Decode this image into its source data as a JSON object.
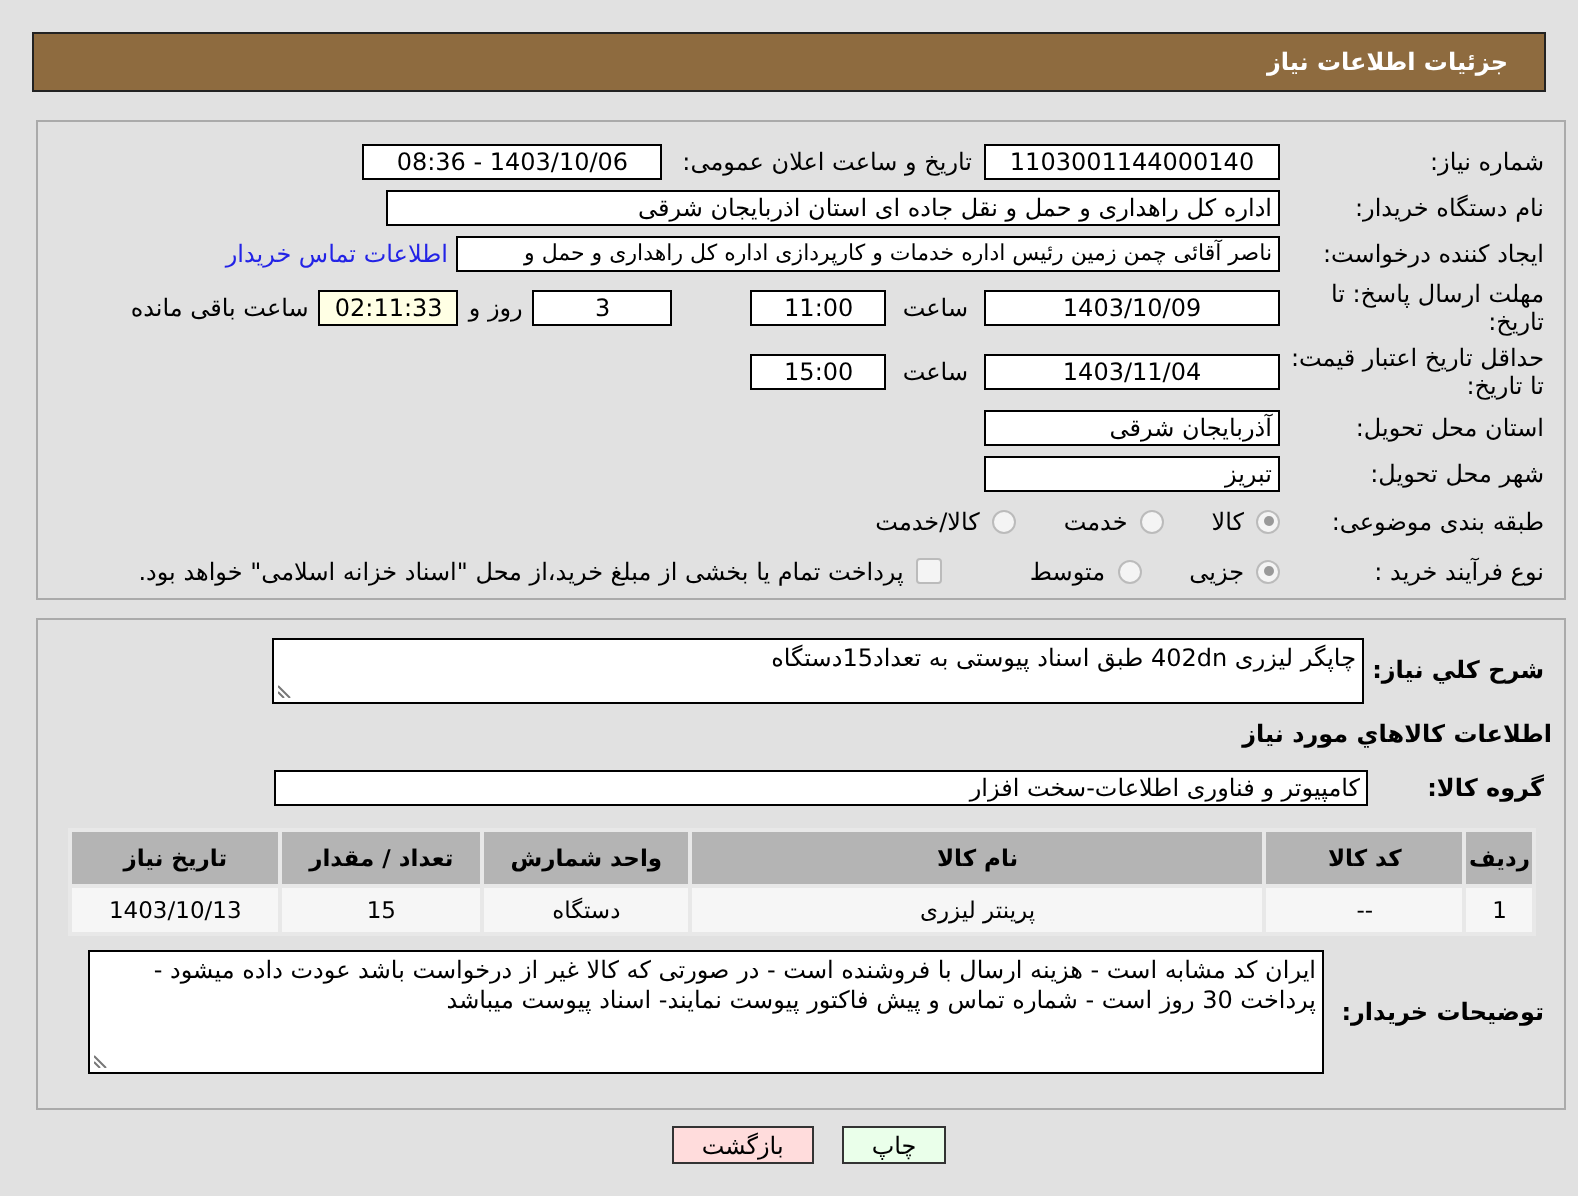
{
  "header": {
    "title": "جزئیات اطلاعات نیاز"
  },
  "need_number": {
    "label": "شماره نیاز:",
    "value": "1103001144000140"
  },
  "announce": {
    "label": "تاریخ و ساعت اعلان عمومی:",
    "value": "1403/10/06 - 08:36"
  },
  "buyer": {
    "label": "نام دستگاه خریدار:",
    "value": "اداره کل راهداری و حمل و نقل جاده ای استان اذربایجان شرقی"
  },
  "requester": {
    "label": "ایجاد کننده درخواست:",
    "value": "ناصر آقائی چمن زمین رئیس اداره خدمات و کارپردازی اداره کل راهداری و حمل و",
    "link": "اطلاعات تماس خریدار"
  },
  "deadline": {
    "label": "مهلت ارسال پاسخ: تا تاریخ:",
    "date": "1403/10/09",
    "time_label": "ساعت",
    "time": "11:00",
    "days": "3",
    "days_label": "روز و",
    "remaining": "02:11:33",
    "remaining_label": "ساعت باقی مانده"
  },
  "validity": {
    "label": "حداقل تاریخ اعتبار قیمت: تا تاریخ:",
    "date": "1403/11/04",
    "time_label": "ساعت",
    "time": "15:00"
  },
  "province": {
    "label": "استان محل تحویل:",
    "value": "آذربایجان شرقی"
  },
  "city": {
    "label": "شهر محل تحویل:",
    "value": "تبریز"
  },
  "category": {
    "label": "طبقه بندی موضوعی:",
    "options": [
      {
        "label": "کالا",
        "selected": true
      },
      {
        "label": "خدمت",
        "selected": false
      },
      {
        "label": "کالا/خدمت",
        "selected": false
      }
    ]
  },
  "process": {
    "label": "نوع فرآیند خرید :",
    "options": [
      {
        "label": "جزیی",
        "selected": true
      },
      {
        "label": "متوسط",
        "selected": false
      }
    ],
    "payment": {
      "label": "پرداخت تمام یا بخشی از مبلغ خرید،از محل \"اسناد خزانه اسلامی\" خواهد بود.",
      "checked": false
    }
  },
  "description": {
    "label": "شرح كلي نياز:",
    "value": "چاپگر لیزری 402dn طبق اسناد پیوستی به تعداد15دستگاه"
  },
  "goods_title": "اطلاعات كالاهاي مورد نياز",
  "goods_group": {
    "label": "گروه کالا:",
    "value": "کامپیوتر و فناوری اطلاعات-سخت افزار"
  },
  "table": {
    "columns": [
      "ردیف",
      "کد کالا",
      "نام کالا",
      "واحد شمارش",
      "تعداد / مقدار",
      "تاریخ نیاز"
    ],
    "rows": [
      [
        "1",
        "--",
        "پرینتر لیزری",
        "دستگاه",
        "15",
        "1403/10/13"
      ]
    ]
  },
  "notes": {
    "label": "توضیحات خریدار:",
    "value": "ایران کد مشابه است - هزینه ارسال با فروشنده است - در صورتی که کالا غیر از درخواست  باشد عودت داده میشود - پرداخت 30 روز است - شماره تماس و پیش فاکتور پیوست نمایند- اسناد پیوست میباشد"
  },
  "buttons": [
    {
      "label": "چاپ",
      "kind": "print"
    },
    {
      "label": "بازگشت",
      "kind": "back"
    }
  ]
}
